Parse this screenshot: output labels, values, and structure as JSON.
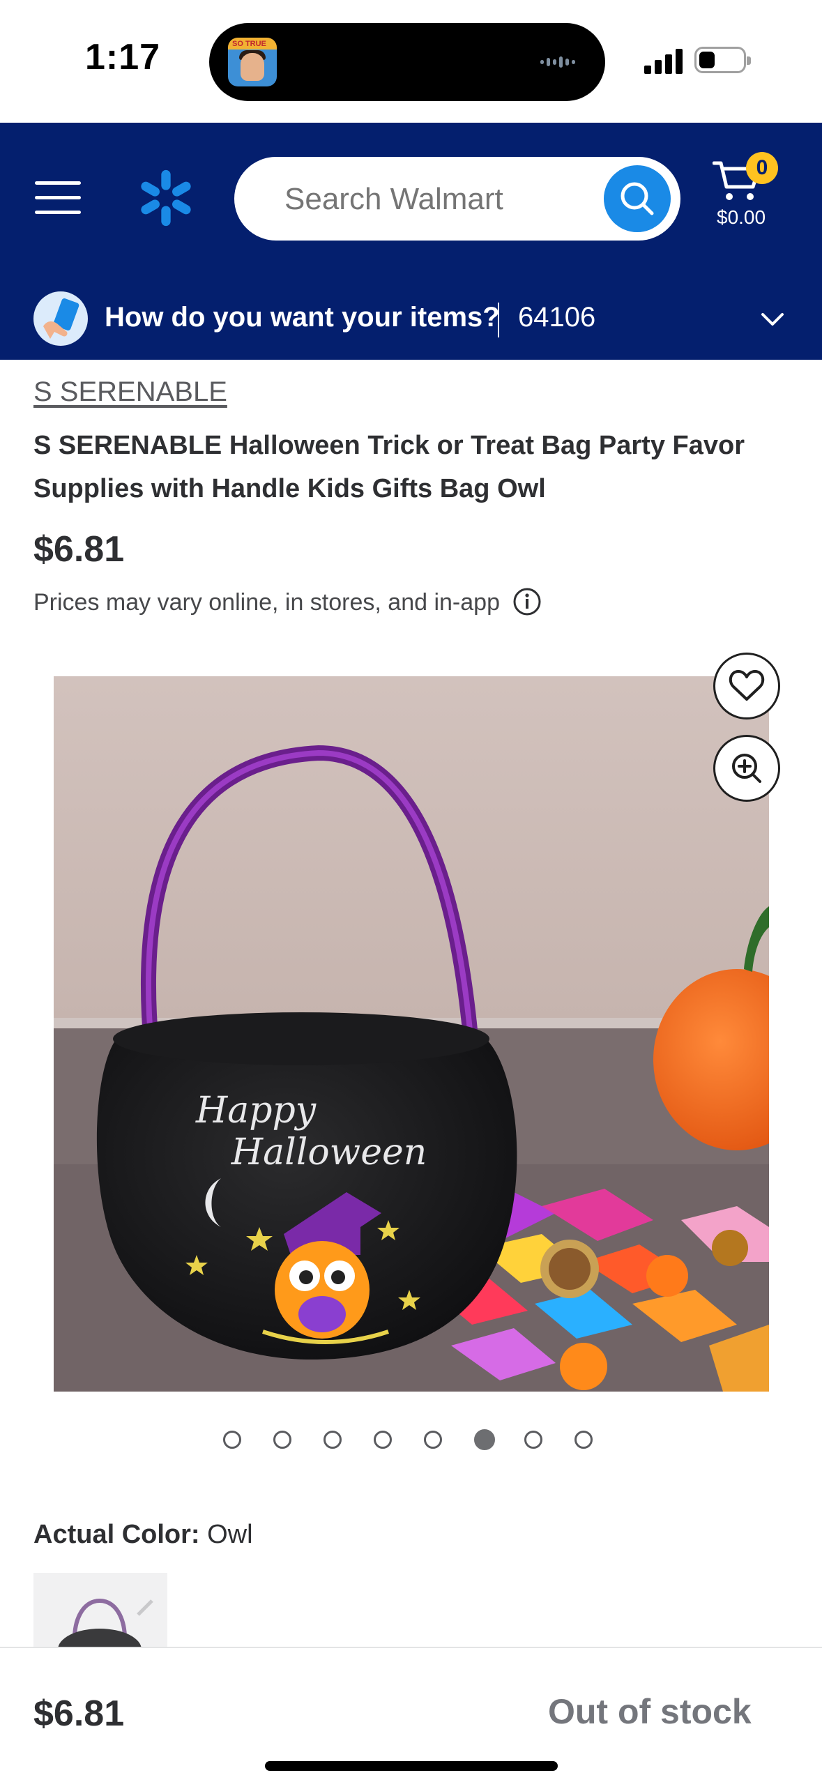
{
  "status_bar": {
    "time": "1:17"
  },
  "header": {
    "search": {
      "placeholder": "Search Walmart"
    },
    "cart": {
      "count": "0",
      "total": "$0.00"
    },
    "delivery": {
      "prompt": "How do you want your items?",
      "zip": "64106"
    },
    "colors": {
      "background": "#041f6e",
      "spark": "#1a8ae6",
      "badge": "#ffc220"
    }
  },
  "product": {
    "brand": "S SERENABLE",
    "title": "S SERENABLE Halloween Trick or Treat Bag Party Favor Supplies with Handle Kids Gifts Bag Owl",
    "price": "$6.81",
    "price_note": "Prices may vary online, in stores, and in-app",
    "image_text_line1": "Happy",
    "image_text_line2": "Halloween",
    "gallery": {
      "total_images": 8,
      "active_index": 6
    },
    "color": {
      "label": "Actual Color:",
      "value": "Owl"
    }
  },
  "footer": {
    "price": "$6.81",
    "stock_status": "Out of stock"
  }
}
